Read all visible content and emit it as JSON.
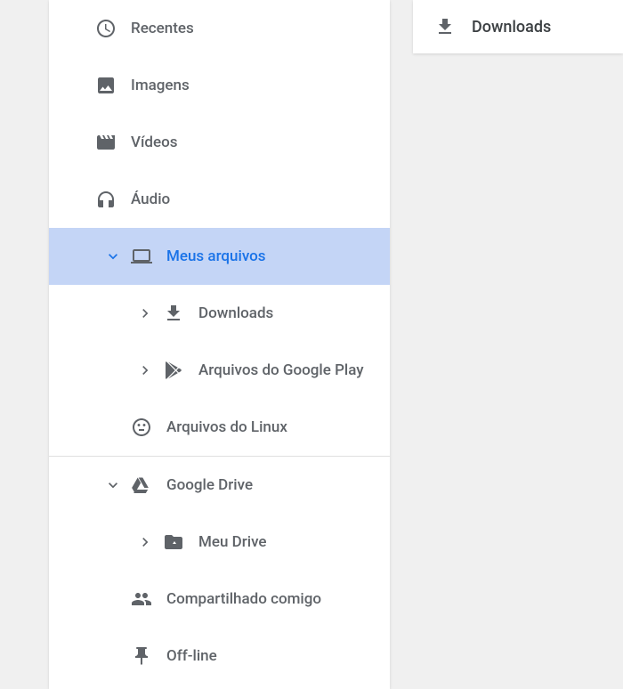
{
  "sidebar": {
    "recentes": "Recentes",
    "imagens": "Imagens",
    "videos": "Vídeos",
    "audio": "Áudio",
    "meus_arquivos": "Meus arquivos",
    "downloads": "Downloads",
    "google_play": "Arquivos do Google Play",
    "linux": "Arquivos do Linux",
    "google_drive": "Google Drive",
    "meu_drive": "Meu Drive",
    "compartilhado": "Compartilhado comigo",
    "offline": "Off-line"
  },
  "main": {
    "downloads": "Downloads"
  }
}
